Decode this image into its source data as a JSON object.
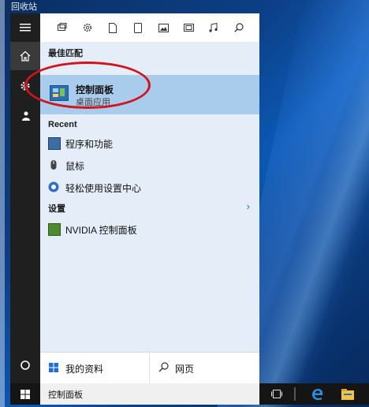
{
  "desktop": {
    "recycle_bin": "回收站"
  },
  "start_rail": {
    "icons": [
      "hamburger-icon",
      "home-icon",
      "gear-icon",
      "user-icon",
      "power-icon"
    ]
  },
  "toolbar": {
    "icons": [
      "apps-icon",
      "settings-icon",
      "document-icon",
      "tablet-icon",
      "image-icon",
      "video-icon",
      "music-icon",
      "search-icon"
    ]
  },
  "results": {
    "best_match_header": "最佳匹配",
    "best_match": {
      "title": "控制面板",
      "subtitle": "桌面应用"
    },
    "recent_header": "Recent",
    "recent": [
      "程序和功能",
      "鼠标",
      "轻松使用设置中心"
    ],
    "settings_header": "设置",
    "settings": [
      "NVIDIA 控制面板"
    ]
  },
  "bottom": {
    "my_stuff": "我的资料",
    "web": "网页"
  },
  "taskbar": {
    "search_text": "控制面板"
  },
  "colors": {
    "highlight": "#a9cbec",
    "results_bg": "#e5eef8",
    "annotation": "#d2141b",
    "accent": "#1f6fce"
  }
}
